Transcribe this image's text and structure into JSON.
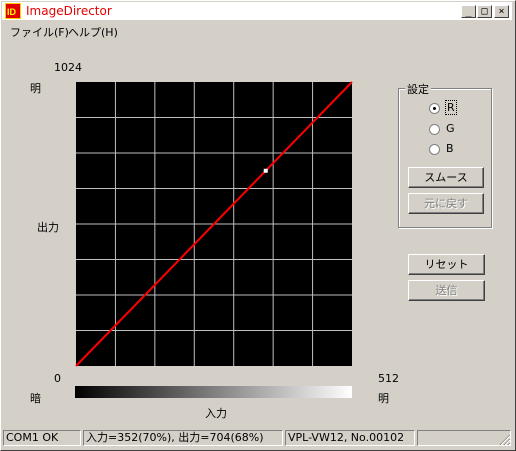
{
  "window": {
    "title": "ImageDirector"
  },
  "menu": [
    "ファイル(F)",
    "ヘルプ(H)"
  ],
  "graph": {
    "y_max_label": "1024",
    "y_min_label": "0",
    "x_max_label": "512",
    "bright_label_top": "明",
    "dark_label_bottom": "暗",
    "bright_label_right": "明",
    "y_axis_label": "出力",
    "x_axis_label": "入力",
    "colors": {
      "background": "#000000",
      "grid": "#c0c0c0",
      "curve": "#ff0000",
      "point": "#ffffff"
    }
  },
  "chart_data": {
    "type": "line",
    "title": "",
    "xlabel": "入力",
    "ylabel": "出力",
    "xlim": [
      0,
      512
    ],
    "ylim": [
      0,
      1024
    ],
    "grid": true,
    "series": [
      {
        "x": [
          0,
          512
        ],
        "y": [
          0,
          1024
        ]
      }
    ],
    "marker": {
      "x": 352,
      "y": 704
    }
  },
  "settings": {
    "group_title": "設定",
    "channels": [
      {
        "label": "R",
        "selected": true
      },
      {
        "label": "G",
        "selected": false
      },
      {
        "label": "B",
        "selected": false
      }
    ],
    "smooth_button": "スムース",
    "revert_button": "元に戻す"
  },
  "reset_button": "リセット",
  "send_button": "送信",
  "status": {
    "port": "COM1 OK",
    "io": "入力=352(70%), 出力=704(68%)",
    "device": "VPL-VW12, No.00102"
  }
}
